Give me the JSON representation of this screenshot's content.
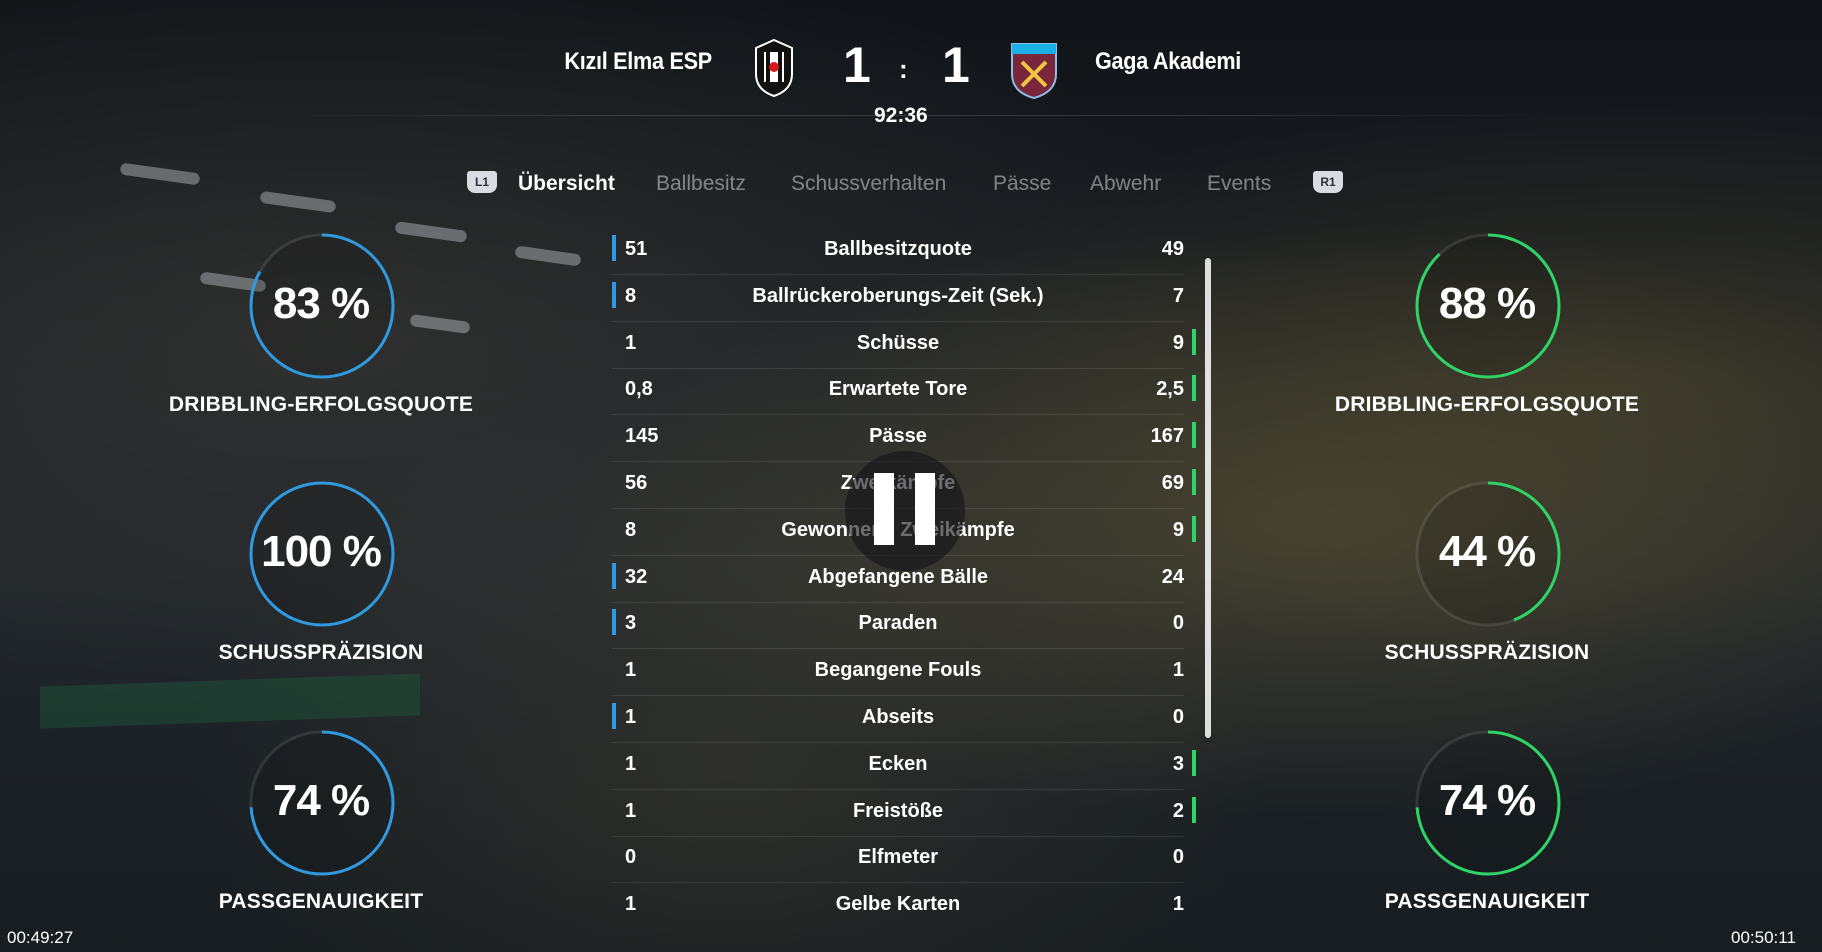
{
  "match": {
    "home_team": "Kızıl Elma ESP",
    "away_team": "Gaga Akademi",
    "home_score": "1",
    "away_score": "1",
    "separator": ":",
    "clock": "92:36",
    "home_crest": "besiktas-crest-icon",
    "away_crest": "west-ham-crest-icon"
  },
  "tabs": {
    "left_shoulder": "L1",
    "right_shoulder": "R1",
    "items": [
      {
        "label": "Übersicht",
        "active": true
      },
      {
        "label": "Ballbesitz",
        "active": false
      },
      {
        "label": "Schussverhalten",
        "active": false
      },
      {
        "label": "Pässe",
        "active": false
      },
      {
        "label": "Abwehr",
        "active": false
      },
      {
        "label": "Events",
        "active": false
      }
    ]
  },
  "stats": [
    {
      "label": "Ballbesitzquote",
      "home": "51",
      "away": "49",
      "lead": "home"
    },
    {
      "label": "Ballrückeroberungs-Zeit (Sek.)",
      "home": "8",
      "away": "7",
      "lead": "home"
    },
    {
      "label": "Schüsse",
      "home": "1",
      "away": "9",
      "lead": "away"
    },
    {
      "label": "Erwartete Tore",
      "home": "0,8",
      "away": "2,5",
      "lead": "away"
    },
    {
      "label": "Pässe",
      "home": "145",
      "away": "167",
      "lead": "away"
    },
    {
      "label": "Zweikämpfe",
      "home": "56",
      "away": "69",
      "lead": "away"
    },
    {
      "label": "Gewonnene Zweikämpfe",
      "home": "8",
      "away": "9",
      "lead": "away"
    },
    {
      "label": "Abgefangene Bälle",
      "home": "32",
      "away": "24",
      "lead": "home"
    },
    {
      "label": "Paraden",
      "home": "3",
      "away": "0",
      "lead": "home"
    },
    {
      "label": "Begangene Fouls",
      "home": "1",
      "away": "1",
      "lead": "none"
    },
    {
      "label": "Abseits",
      "home": "1",
      "away": "0",
      "lead": "home"
    },
    {
      "label": "Ecken",
      "home": "1",
      "away": "3",
      "lead": "away"
    },
    {
      "label": "Freistöße",
      "home": "1",
      "away": "2",
      "lead": "away"
    },
    {
      "label": "Elfmeter",
      "home": "0",
      "away": "0",
      "lead": "none"
    },
    {
      "label": "Gelbe Karten",
      "home": "1",
      "away": "1",
      "lead": "none"
    }
  ],
  "home_rings": [
    {
      "value": "83 %",
      "percent": 83,
      "label": "DRIBBLING-ERFOLGSQUOTE"
    },
    {
      "value": "100 %",
      "percent": 100,
      "label": "SCHUSSPRÄZISION"
    },
    {
      "value": "74 %",
      "percent": 74,
      "label": "PASSGENAUIGKEIT"
    }
  ],
  "away_rings": [
    {
      "value": "88 %",
      "percent": 88,
      "label": "DRIBBLING-ERFOLGSQUOTE"
    },
    {
      "value": "44 %",
      "percent": 44,
      "label": "SCHUSSPRÄZISION"
    },
    {
      "value": "74 %",
      "percent": 74,
      "label": "PASSGENAUIGKEIT"
    }
  ],
  "colors": {
    "home": "#2f9ae0",
    "away": "#2fd467"
  },
  "video": {
    "elapsed": "00:49:27",
    "total": "00:50:11",
    "state": "paused"
  }
}
